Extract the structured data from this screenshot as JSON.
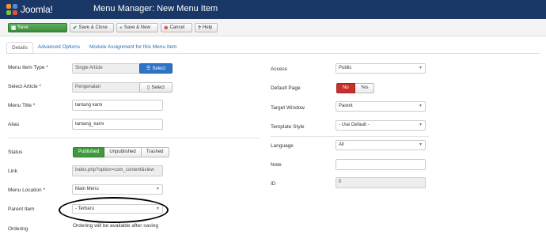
{
  "app": {
    "logo_text": "Joomla!",
    "title": "Menu Manager: New Menu Item"
  },
  "toolbar": {
    "save": "Save",
    "save_close": "Save & Close",
    "save_new": "Save & New",
    "cancel": "Cancel",
    "help": "Help"
  },
  "tabs": [
    "Details",
    "Advanced Options",
    "Module Assignment for this Menu Item"
  ],
  "left": {
    "menu_item_type": {
      "label": "Menu Item Type *",
      "value": "Single Article",
      "button": "Select"
    },
    "select_article": {
      "label": "Select Article *",
      "value": "Pengenalan",
      "button": "Select"
    },
    "menu_title": {
      "label": "Menu Title *",
      "value": "tantang kami"
    },
    "alias": {
      "label": "Alias",
      "value": "tantang_kami"
    },
    "status": {
      "label": "Status",
      "options": [
        "Published",
        "Unpublished",
        "Trashed"
      ],
      "selected": "Published"
    },
    "link": {
      "label": "Link",
      "value": "index.php?option=com_content&view"
    },
    "menu_location": {
      "label": "Menu Location *",
      "value": "Main Menu"
    },
    "parent_item": {
      "label": "Parent Item",
      "value": "- Terbaru"
    },
    "ordering": {
      "label": "Ordering",
      "value": "Ordering will be available after saving"
    }
  },
  "right": {
    "access": {
      "label": "Access",
      "value": "Public"
    },
    "default_page": {
      "label": "Default Page",
      "options": [
        "No",
        "Yes"
      ],
      "selected": "No"
    },
    "target_window": {
      "label": "Target Window",
      "value": "Parent"
    },
    "template_style": {
      "label": "Template Style",
      "value": "- Use Default -"
    },
    "language": {
      "label": "Language",
      "value": "All"
    },
    "note": {
      "label": "Note",
      "value": ""
    },
    "id": {
      "label": "ID",
      "value": "0"
    }
  },
  "colors": {
    "header": "#1a3867",
    "save": "#3b8a3b",
    "select_button": "#2f73c8",
    "published": "#3f9a3f",
    "no": "#c9302c"
  }
}
